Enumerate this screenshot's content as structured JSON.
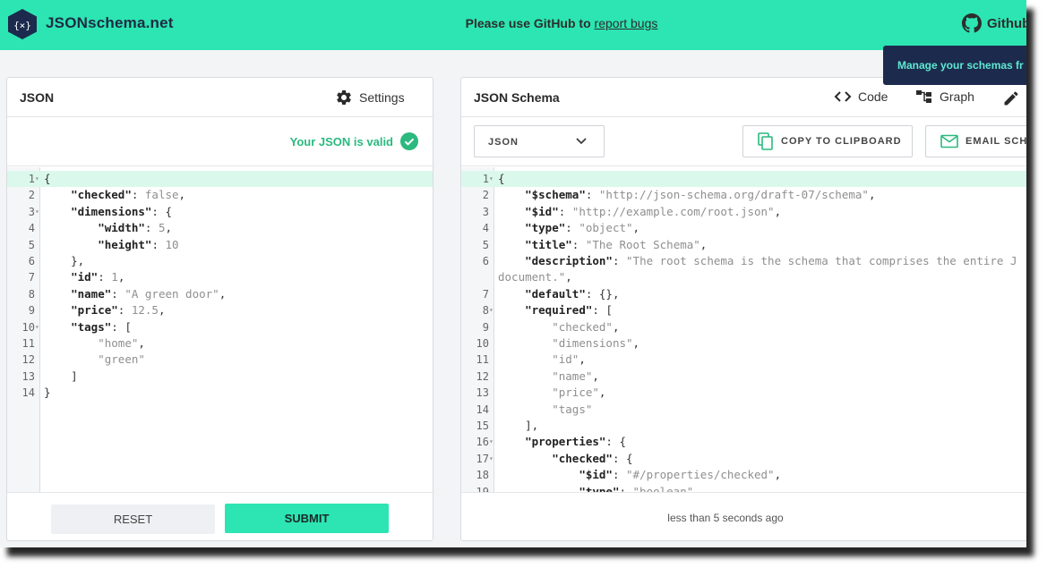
{
  "app": {
    "brand": "JSONschema.net",
    "notice_prefix": "Please use GitHub to",
    "notice_link": "report bugs",
    "github_label": "Github",
    "toast": "Manage your schemas fr",
    "accent_color": "#2ce5b2"
  },
  "left": {
    "title": "JSON",
    "settings_label": "Settings",
    "valid_text": "Your JSON is valid",
    "reset_label": "RESET",
    "submit_label": "SUBMIT",
    "lines": [
      {
        "n": "1",
        "fold": true,
        "tokens": [
          [
            "pun",
            "{"
          ]
        ]
      },
      {
        "n": "2",
        "fold": false,
        "tokens": [
          [
            "pun",
            "    "
          ],
          [
            "key",
            "\"checked\""
          ],
          [
            "pun",
            ": "
          ],
          [
            "str",
            "false"
          ],
          [
            "pun",
            ","
          ]
        ]
      },
      {
        "n": "3",
        "fold": true,
        "tokens": [
          [
            "pun",
            "    "
          ],
          [
            "key",
            "\"dimensions\""
          ],
          [
            "pun",
            ": {"
          ]
        ]
      },
      {
        "n": "4",
        "fold": false,
        "tokens": [
          [
            "pun",
            "        "
          ],
          [
            "key",
            "\"width\""
          ],
          [
            "pun",
            ": "
          ],
          [
            "num",
            "5"
          ],
          [
            "pun",
            ","
          ]
        ]
      },
      {
        "n": "5",
        "fold": false,
        "tokens": [
          [
            "pun",
            "        "
          ],
          [
            "key",
            "\"height\""
          ],
          [
            "pun",
            ": "
          ],
          [
            "num",
            "10"
          ]
        ]
      },
      {
        "n": "6",
        "fold": false,
        "tokens": [
          [
            "pun",
            "    },"
          ]
        ]
      },
      {
        "n": "7",
        "fold": false,
        "tokens": [
          [
            "pun",
            "    "
          ],
          [
            "key",
            "\"id\""
          ],
          [
            "pun",
            ": "
          ],
          [
            "num",
            "1"
          ],
          [
            "pun",
            ","
          ]
        ]
      },
      {
        "n": "8",
        "fold": false,
        "tokens": [
          [
            "pun",
            "    "
          ],
          [
            "key",
            "\"name\""
          ],
          [
            "pun",
            ": "
          ],
          [
            "str",
            "\"A green door\""
          ],
          [
            "pun",
            ","
          ]
        ]
      },
      {
        "n": "9",
        "fold": false,
        "tokens": [
          [
            "pun",
            "    "
          ],
          [
            "key",
            "\"price\""
          ],
          [
            "pun",
            ": "
          ],
          [
            "num",
            "12.5"
          ],
          [
            "pun",
            ","
          ]
        ]
      },
      {
        "n": "10",
        "fold": true,
        "tokens": [
          [
            "pun",
            "    "
          ],
          [
            "key",
            "\"tags\""
          ],
          [
            "pun",
            ": ["
          ]
        ]
      },
      {
        "n": "11",
        "fold": false,
        "tokens": [
          [
            "pun",
            "        "
          ],
          [
            "str",
            "\"home\""
          ],
          [
            "pun",
            ","
          ]
        ]
      },
      {
        "n": "12",
        "fold": false,
        "tokens": [
          [
            "pun",
            "        "
          ],
          [
            "str",
            "\"green\""
          ]
        ]
      },
      {
        "n": "13",
        "fold": false,
        "tokens": [
          [
            "pun",
            "    ]"
          ]
        ]
      },
      {
        "n": "14",
        "fold": false,
        "tokens": [
          [
            "pun",
            "}"
          ]
        ]
      }
    ]
  },
  "right": {
    "title": "JSON Schema",
    "tab_code": "Code",
    "tab_graph": "Graph",
    "select_value": "JSON",
    "copy_label": "COPY TO CLIPBOARD",
    "email_label": "EMAIL SCHE",
    "footer_status": "less than 5 seconds ago",
    "lines": [
      {
        "n": "1",
        "fold": true,
        "tokens": [
          [
            "pun",
            "{"
          ]
        ]
      },
      {
        "n": "2",
        "fold": false,
        "tokens": [
          [
            "pun",
            "    "
          ],
          [
            "key",
            "\"$schema\""
          ],
          [
            "pun",
            ": "
          ],
          [
            "str",
            "\"http://json-schema.org/draft-07/schema\""
          ],
          [
            "pun",
            ","
          ]
        ]
      },
      {
        "n": "3",
        "fold": false,
        "tokens": [
          [
            "pun",
            "    "
          ],
          [
            "key",
            "\"$id\""
          ],
          [
            "pun",
            ": "
          ],
          [
            "str",
            "\"http://example.com/root.json\""
          ],
          [
            "pun",
            ","
          ]
        ]
      },
      {
        "n": "4",
        "fold": false,
        "tokens": [
          [
            "pun",
            "    "
          ],
          [
            "key",
            "\"type\""
          ],
          [
            "pun",
            ": "
          ],
          [
            "str",
            "\"object\""
          ],
          [
            "pun",
            ","
          ]
        ]
      },
      {
        "n": "5",
        "fold": false,
        "tokens": [
          [
            "pun",
            "    "
          ],
          [
            "key",
            "\"title\""
          ],
          [
            "pun",
            ": "
          ],
          [
            "str",
            "\"The Root Schema\""
          ],
          [
            "pun",
            ","
          ]
        ]
      },
      {
        "n": "6",
        "fold": false,
        "tokens": [
          [
            "pun",
            "    "
          ],
          [
            "key",
            "\"description\""
          ],
          [
            "pun",
            ": "
          ],
          [
            "str",
            "\"The root schema is the schema that comprises the entire J"
          ]
        ]
      },
      {
        "n": "",
        "fold": false,
        "tokens": [
          [
            "str",
            "document.\""
          ],
          [
            "pun",
            ","
          ]
        ]
      },
      {
        "n": "7",
        "fold": false,
        "tokens": [
          [
            "pun",
            "    "
          ],
          [
            "key",
            "\"default\""
          ],
          [
            "pun",
            ": {},"
          ]
        ]
      },
      {
        "n": "8",
        "fold": true,
        "tokens": [
          [
            "pun",
            "    "
          ],
          [
            "key",
            "\"required\""
          ],
          [
            "pun",
            ": ["
          ]
        ]
      },
      {
        "n": "9",
        "fold": false,
        "tokens": [
          [
            "pun",
            "        "
          ],
          [
            "str",
            "\"checked\""
          ],
          [
            "pun",
            ","
          ]
        ]
      },
      {
        "n": "10",
        "fold": false,
        "tokens": [
          [
            "pun",
            "        "
          ],
          [
            "str",
            "\"dimensions\""
          ],
          [
            "pun",
            ","
          ]
        ]
      },
      {
        "n": "11",
        "fold": false,
        "tokens": [
          [
            "pun",
            "        "
          ],
          [
            "str",
            "\"id\""
          ],
          [
            "pun",
            ","
          ]
        ]
      },
      {
        "n": "12",
        "fold": false,
        "tokens": [
          [
            "pun",
            "        "
          ],
          [
            "str",
            "\"name\""
          ],
          [
            "pun",
            ","
          ]
        ]
      },
      {
        "n": "13",
        "fold": false,
        "tokens": [
          [
            "pun",
            "        "
          ],
          [
            "str",
            "\"price\""
          ],
          [
            "pun",
            ","
          ]
        ]
      },
      {
        "n": "14",
        "fold": false,
        "tokens": [
          [
            "pun",
            "        "
          ],
          [
            "str",
            "\"tags\""
          ]
        ]
      },
      {
        "n": "15",
        "fold": false,
        "tokens": [
          [
            "pun",
            "    ],"
          ]
        ]
      },
      {
        "n": "16",
        "fold": true,
        "tokens": [
          [
            "pun",
            "    "
          ],
          [
            "key",
            "\"properties\""
          ],
          [
            "pun",
            ": {"
          ]
        ]
      },
      {
        "n": "17",
        "fold": true,
        "tokens": [
          [
            "pun",
            "        "
          ],
          [
            "key",
            "\"checked\""
          ],
          [
            "pun",
            ": {"
          ]
        ]
      },
      {
        "n": "18",
        "fold": false,
        "tokens": [
          [
            "pun",
            "            "
          ],
          [
            "key",
            "\"$id\""
          ],
          [
            "pun",
            ": "
          ],
          [
            "str",
            "\"#/properties/checked\""
          ],
          [
            "pun",
            ","
          ]
        ]
      },
      {
        "n": "19",
        "fold": false,
        "tokens": [
          [
            "pun",
            "            "
          ],
          [
            "key",
            "\"type\""
          ],
          [
            "pun",
            ": "
          ],
          [
            "str",
            "\"boolean\""
          ],
          [
            "pun",
            ","
          ]
        ]
      }
    ]
  }
}
